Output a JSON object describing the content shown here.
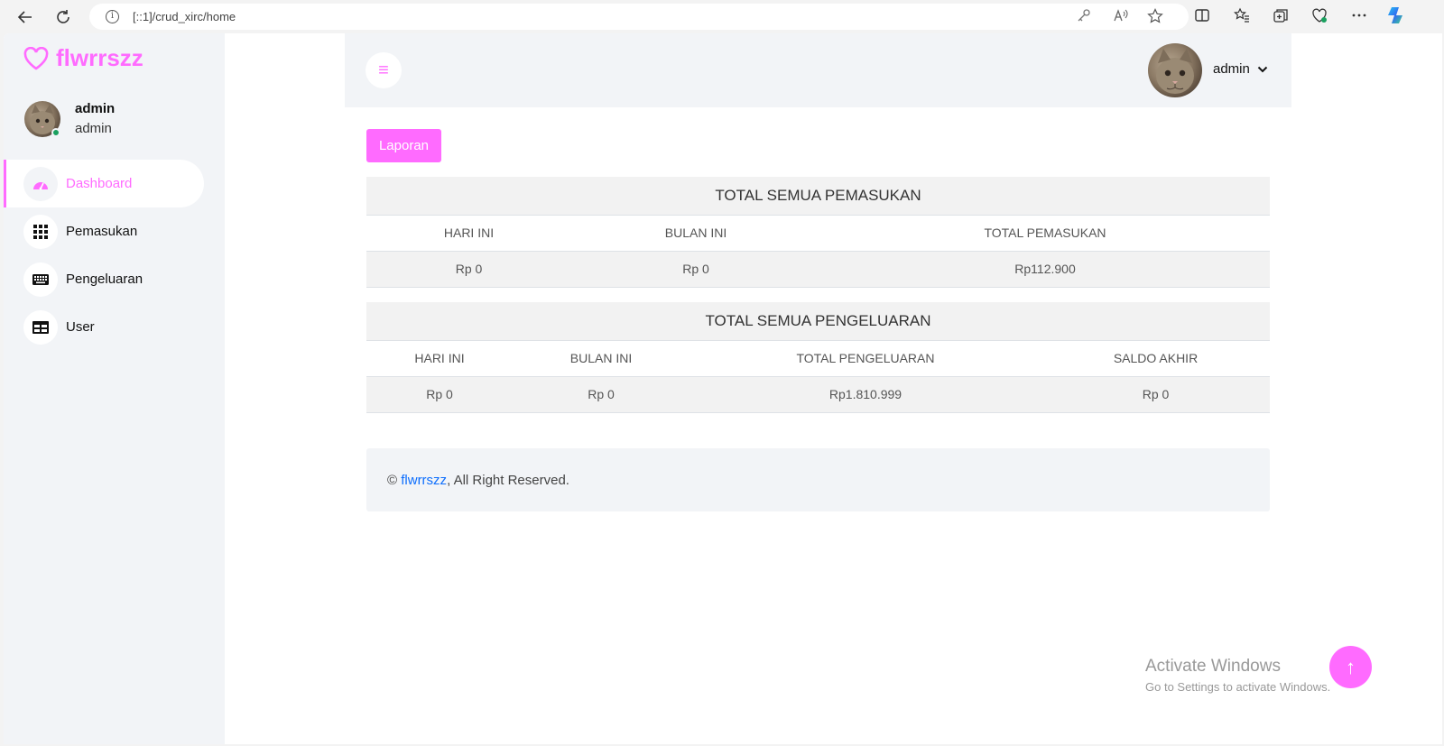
{
  "browser": {
    "url": "[::1]/crud_xirc/home",
    "info_glyph": "i",
    "icons": [
      "back-arrow-icon",
      "refresh-icon",
      "info-icon",
      "key-icon",
      "read-aloud-icon",
      "favorite-star-icon",
      "split-screen-icon",
      "favorites-icon",
      "collections-icon",
      "browser-essentials-icon",
      "more-icon",
      "copilot-icon"
    ]
  },
  "brand": {
    "name": "flwrrszz",
    "color": "#ff6bff"
  },
  "sidebar": {
    "user_name": "admin",
    "user_role": "admin",
    "items": [
      {
        "label": "Dashboard",
        "icon": "speedometer-icon",
        "active": true
      },
      {
        "label": "Pemasukan",
        "icon": "grid-icon",
        "active": false
      },
      {
        "label": "Pengeluaran",
        "icon": "keyboard-icon",
        "active": false
      },
      {
        "label": "User",
        "icon": "table-icon",
        "active": false
      }
    ]
  },
  "topbar": {
    "toggle_glyph": "≡",
    "user_name": "admin",
    "chevron": "⌄"
  },
  "report_button": "Laporan",
  "income": {
    "title": "TOTAL SEMUA PEMASUKAN",
    "headers": [
      "HARI INI",
      "BULAN INI",
      "TOTAL PEMASUKAN"
    ],
    "values": [
      "Rp 0",
      "Rp 0",
      "Rp112.900"
    ]
  },
  "expense": {
    "title": "TOTAL SEMUA PENGELUARAN",
    "headers": [
      "HARI INI",
      "BULAN INI",
      "TOTAL PENGELUARAN",
      "SALDO AKHIR"
    ],
    "values": [
      "Rp 0",
      "Rp 0",
      "Rp1.810.999",
      "Rp 0"
    ]
  },
  "footer": {
    "prefix": "© ",
    "link": "flwrrszz",
    "suffix": ", All Right Reserved."
  },
  "watermark": {
    "line1": "Activate Windows",
    "line2": "Go to Settings to activate Windows."
  },
  "back_to_top_glyph": "↑"
}
